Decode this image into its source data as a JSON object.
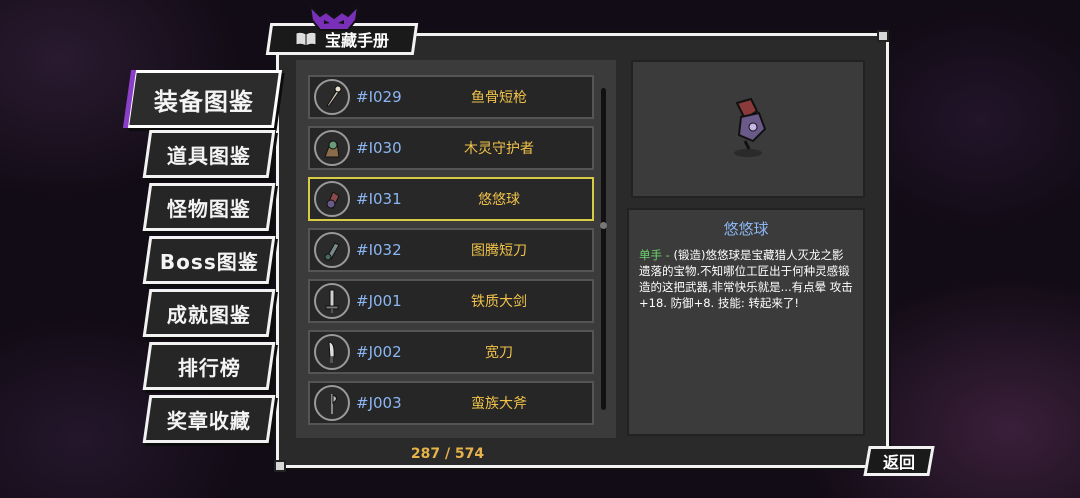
{
  "title": "宝藏手册",
  "nav": [
    {
      "label": "装备图鉴",
      "active": true
    },
    {
      "label": "道具图鉴",
      "active": false
    },
    {
      "label": "怪物图鉴",
      "active": false
    },
    {
      "label": "Boss图鉴",
      "active": false
    },
    {
      "label": "成就图鉴",
      "active": false
    },
    {
      "label": "排行榜",
      "active": false
    },
    {
      "label": "奖章收藏",
      "active": false
    }
  ],
  "list": [
    {
      "id": "#I029",
      "name": "鱼骨短枪",
      "icon": "spear-icon"
    },
    {
      "id": "#I030",
      "name": "木灵守护者",
      "icon": "wood-spirit-icon"
    },
    {
      "id": "#I031",
      "name": "悠悠球",
      "icon": "yoyo-icon",
      "selected": true
    },
    {
      "id": "#I032",
      "name": "图腾短刀",
      "icon": "totem-dagger-icon"
    },
    {
      "id": "#J001",
      "name": "铁质大剑",
      "icon": "greatsword-icon"
    },
    {
      "id": "#J002",
      "name": "宽刀",
      "icon": "broadblade-icon"
    },
    {
      "id": "#J003",
      "name": "蛮族大斧",
      "icon": "axe-icon"
    }
  ],
  "counter": "287 / 574",
  "detail": {
    "name": "悠悠球",
    "hand_type": "单手 -",
    "description": " (锻造)悠悠球是宝藏猎人灭龙之影遗落的宝物.不知哪位工匠出于何种灵感锻造的这把武器,非常快乐就是...有点晕 攻击+18. 防御+8. 技能: 转起来了!"
  },
  "back_label": "返回",
  "colors": {
    "accent_purple": "#8a3fc8",
    "id_blue": "#8bb6f2",
    "name_gold": "#f0c24a",
    "selected_border": "#d7cc43",
    "hand_green": "#6bd36b"
  }
}
